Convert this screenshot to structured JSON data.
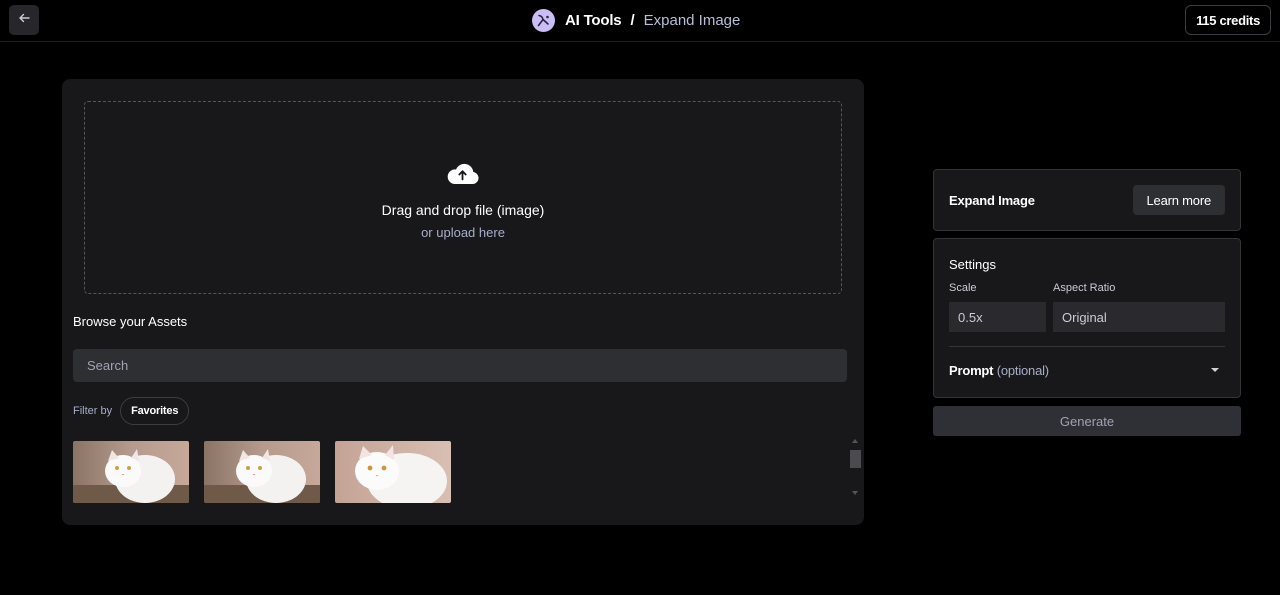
{
  "header": {
    "back_icon": "arrow-left-icon",
    "app_name": "AI Tools",
    "separator": "/",
    "page_name": "Expand Image",
    "credits": "115 credits"
  },
  "upload": {
    "icon": "cloud-upload-icon",
    "title": "Drag and drop file (image)",
    "subtitle": "or upload here"
  },
  "assets": {
    "title": "Browse your Assets",
    "search_placeholder": "Search",
    "filter_label": "Filter by",
    "filter_chip": "Favorites",
    "thumbnails": [
      {
        "alt": "white cat"
      },
      {
        "alt": "white cat"
      },
      {
        "alt": "white cat"
      }
    ]
  },
  "expand_card": {
    "title": "Expand Image",
    "learn_more": "Learn more"
  },
  "settings": {
    "title": "Settings",
    "scale_label": "Scale",
    "scale_value": "0.5x",
    "aspect_label": "Aspect Ratio",
    "aspect_value": "Original",
    "prompt_label": "Prompt",
    "prompt_optional": "(optional)"
  },
  "actions": {
    "generate": "Generate"
  },
  "colors": {
    "background": "#000000",
    "panel": "#18181b",
    "input": "#2e2f33",
    "accent_text": "#a6adc8"
  }
}
